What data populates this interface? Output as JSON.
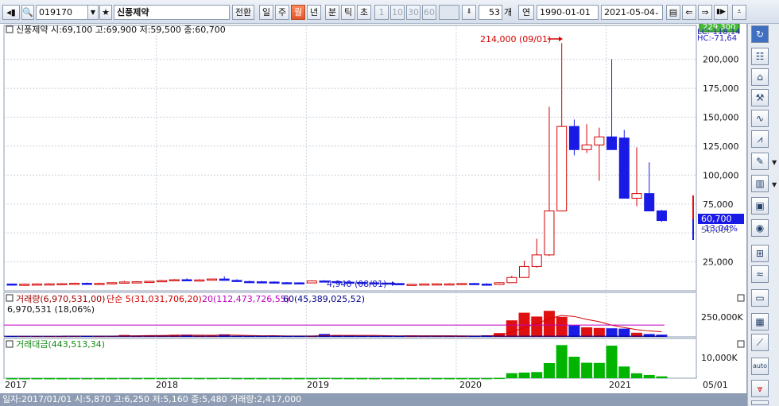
{
  "toolbar": {
    "code": "019170",
    "name": "신풍제약",
    "convert_label": "전환",
    "periods": [
      "일",
      "주",
      "월",
      "년",
      "분",
      "틱",
      "초"
    ],
    "active_period": "월",
    "intervals": [
      "1",
      "10",
      "30",
      "60"
    ],
    "count": "53",
    "count_unit": "개",
    "link_label": "연",
    "date_from": "1990-01-01",
    "date_to": "2021-05-04"
  },
  "chart": {
    "legend": "신풍제약 시:69,100 고:69,900 저:59,500 종:60,700",
    "high_marker": "214,000 (09/01)",
    "low_marker": "4,940 (08/01)",
    "top_price_box": "229,300",
    "indicator_lines": [
      "LC:-118,14",
      "HC:-71,64"
    ],
    "price_ticks": [
      "200,000",
      "175,000",
      "150,000",
      "125,000",
      "100,000",
      "75,000",
      "25,000"
    ],
    "hidden_tick": "50,000",
    "current_price": "60,700",
    "current_change": "-13,04%",
    "volume_legend": [
      {
        "text": "거래량(6,970,531,00)",
        "color": "#a00000"
      },
      {
        "text": "단순 5(31,031,706,20)",
        "color": "#d40000"
      },
      {
        "text": "20(112,473,726,55)",
        "color": "#c000c0"
      },
      {
        "text": "60(45,389,025,52)",
        "color": "#00008b"
      }
    ],
    "volume_sub": "6,970,531 (18,06%)",
    "volume_tick": "250,000K",
    "amount_legend": "거래대금(443,513,34)",
    "amount_tick": "10,000K",
    "x_labels": [
      "2017",
      "2018",
      "2019",
      "2020",
      "2021",
      "05/01"
    ]
  },
  "status": "일자:2017/01/01  시:5,870  고:6,250  저:5,160  종:5,480  거래량:2,417,000",
  "chart_data": {
    "type": "candlestick",
    "period": "monthly",
    "categories": [
      "2017-01",
      "2017-02",
      "2017-03",
      "2017-04",
      "2017-05",
      "2017-06",
      "2017-07",
      "2017-08",
      "2017-09",
      "2017-10",
      "2017-11",
      "2017-12",
      "2018-01",
      "2018-02",
      "2018-03",
      "2018-04",
      "2018-05",
      "2018-06",
      "2018-07",
      "2018-08",
      "2018-09",
      "2018-10",
      "2018-11",
      "2018-12",
      "2019-01",
      "2019-02",
      "2019-03",
      "2019-04",
      "2019-05",
      "2019-06",
      "2019-07",
      "2019-08",
      "2019-09",
      "2019-10",
      "2019-11",
      "2019-12",
      "2020-01",
      "2020-02",
      "2020-03",
      "2020-04",
      "2020-05",
      "2020-06",
      "2020-07",
      "2020-08",
      "2020-09",
      "2020-10",
      "2020-11",
      "2020-12",
      "2021-01",
      "2021-02",
      "2021-03",
      "2021-04",
      "2021-05"
    ],
    "open": [
      5870,
      5480,
      5700,
      5900,
      6000,
      6200,
      6500,
      6300,
      6400,
      7000,
      7600,
      7800,
      8200,
      8800,
      9600,
      9000,
      9400,
      10200,
      9000,
      8000,
      7800,
      7600,
      7000,
      6900,
      6800,
      8500,
      8000,
      7500,
      7200,
      6900,
      6700,
      6300,
      5200,
      5600,
      5900,
      6000,
      6000,
      6300,
      5800,
      5500,
      7000,
      11500,
      21000,
      31000,
      69000,
      142000,
      122000,
      126000,
      133000,
      132000,
      80000,
      84000,
      69100
    ],
    "high": [
      6250,
      6300,
      6400,
      6600,
      6700,
      7000,
      7100,
      7000,
      7200,
      8500,
      8200,
      8600,
      9400,
      10200,
      10800,
      10000,
      10400,
      12500,
      10000,
      8800,
      8600,
      8200,
      7600,
      7400,
      9000,
      9200,
      8600,
      8100,
      7700,
      7300,
      7100,
      6600,
      5900,
      6200,
      6400,
      6600,
      6700,
      6900,
      6600,
      7400,
      13000,
      26000,
      45000,
      159000,
      214000,
      148000,
      144000,
      141000,
      200000,
      139000,
      124000,
      111000,
      69900
    ],
    "low": [
      5160,
      5300,
      5500,
      5700,
      5800,
      6000,
      6100,
      6000,
      6200,
      6700,
      7200,
      7500,
      8000,
      8500,
      8800,
      8800,
      9000,
      9500,
      7800,
      7600,
      7400,
      6900,
      6700,
      6500,
      6700,
      7800,
      7400,
      7000,
      6800,
      6500,
      6200,
      5100,
      4940,
      5300,
      5700,
      5800,
      5800,
      5600,
      5000,
      5400,
      6800,
      11000,
      20000,
      30000,
      118000,
      117000,
      119000,
      95000,
      122000,
      90000,
      73000,
      72000,
      59500
    ],
    "close": [
      5480,
      5700,
      5900,
      6000,
      6200,
      6500,
      6300,
      6400,
      7000,
      7600,
      7800,
      8200,
      8800,
      9600,
      9000,
      9400,
      10200,
      9000,
      8000,
      7800,
      7600,
      7000,
      6900,
      6800,
      8500,
      8000,
      7500,
      7200,
      6900,
      6700,
      6300,
      5200,
      5600,
      5900,
      6000,
      6000,
      6300,
      5800,
      5500,
      7000,
      11500,
      21000,
      31000,
      69000,
      142000,
      122000,
      126000,
      133000,
      122000,
      80000,
      84000,
      69000,
      60700
    ],
    "volume_k": [
      2417,
      2600,
      2500,
      2300,
      2100,
      2600,
      2500,
      2200,
      3000,
      6000,
      4000,
      5200,
      4200,
      6500,
      7000,
      4000,
      4000,
      8000,
      3000,
      2600,
      2700,
      3000,
      2900,
      2600,
      3200,
      9000,
      5500,
      3600,
      2800,
      2600,
      3800,
      3500,
      4500,
      3500,
      2600,
      2500,
      2800,
      2700,
      5000,
      12000,
      52000,
      76000,
      64000,
      82000,
      63000,
      36000,
      30000,
      28000,
      27000,
      26000,
      13000,
      9000,
      6970
    ],
    "amount_m": [
      14,
      15,
      15,
      14,
      13,
      17,
      16,
      14,
      21,
      45,
      31,
      42,
      37,
      62,
      67,
      38,
      40,
      91,
      27,
      21,
      21,
      22,
      20,
      18,
      27,
      74,
      43,
      27,
      20,
      18,
      25,
      19,
      24,
      20,
      16,
      15,
      17,
      16,
      27,
      78,
      1200,
      1350,
      1470,
      3620,
      7940,
      5150,
      3700,
      3660,
      7800,
      2800,
      1170,
      780,
      443
    ],
    "ma5_volume_k": [
      null,
      null,
      null,
      null,
      2384,
      2420,
      2440,
      2440,
      2480,
      3060,
      3540,
      4080,
      4480,
      5180,
      5380,
      5340,
      5140,
      5900,
      5200,
      4320,
      3460,
      3860,
      2840,
      2760,
      2880,
      4140,
      4640,
      4780,
      4620,
      4700,
      3660,
      3260,
      3440,
      3440,
      3480,
      3360,
      3180,
      2820,
      3120,
      4920,
      14900,
      29540,
      41800,
      57200,
      67400,
      64200,
      55000,
      47800,
      36800,
      29400,
      22800,
      18600,
      16394
    ],
    "ma20_volume_k": 112473.7,
    "ma60_volume_k": 45389.0,
    "ylim_price": [
      0,
      229300
    ],
    "yticks_price": [
      25000,
      50000,
      75000,
      100000,
      125000,
      150000,
      175000,
      200000
    ],
    "grid": true
  }
}
